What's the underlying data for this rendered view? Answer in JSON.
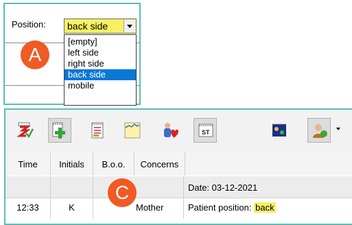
{
  "panel_a": {
    "badge": "A",
    "position_label": "Position:",
    "selected_value": "back side",
    "options": [
      "[empty]",
      "left side",
      "right side",
      "back side",
      "mobile"
    ],
    "selected_index": 3
  },
  "panel_c": {
    "badge": "C",
    "toolbar": {
      "icons": [
        "form-check-icon",
        "add-entry-icon",
        "notes-icon",
        "chart-icon",
        "patient-heart-icon",
        "st-label-icon",
        "records-icon",
        "users-icon"
      ],
      "st_text": "ST"
    },
    "columns": [
      "Time",
      "Initials",
      "B.o.o.",
      "Concerns"
    ],
    "date_row": "Date: 03-12-2021",
    "rows": [
      {
        "time": "12:33",
        "initials": "K",
        "boo": "Mother",
        "note_prefix": "Patient position: ",
        "note_value": "back"
      }
    ]
  },
  "colors": {
    "accent_border": "#5bbcb8",
    "badge": "#f05a24",
    "highlight": "#f7f064",
    "selection": "#0a78d7"
  }
}
